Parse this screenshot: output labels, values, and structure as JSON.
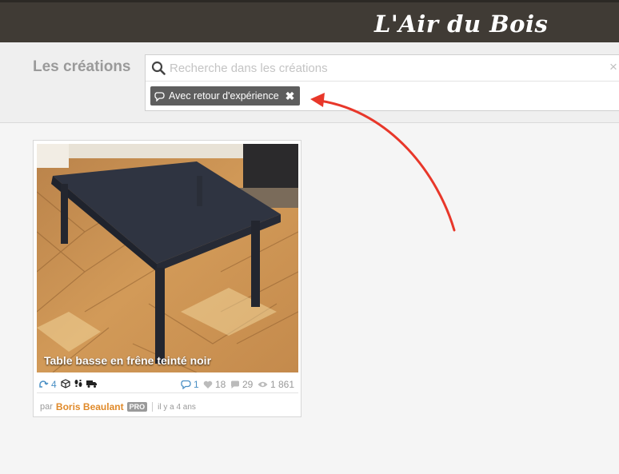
{
  "brand": {
    "name": "L'Air du Bois"
  },
  "search": {
    "section_title": "Les créations",
    "placeholder": "Recherche dans les créations",
    "clear_symbol": "×"
  },
  "filter_tag": {
    "label": "Avec retour d'expérience",
    "remove_symbol": "✖"
  },
  "annotation": {
    "color": "#e8372a"
  },
  "card": {
    "title": "Table basse en frêne teinté noir",
    "stats": {
      "inspirations": "4",
      "feedback": "1",
      "likes": "18",
      "comments": "29",
      "views": "1 861"
    },
    "author": {
      "prefix": "par",
      "name": "Boris Beaulant",
      "badge": "PRO",
      "time": "il y a 4 ans"
    }
  },
  "colors": {
    "topbar": "#403b35",
    "accent_author": "#e08a2a",
    "link_blue": "#4a8fc4",
    "tag_bg": "#5e5e5e"
  }
}
